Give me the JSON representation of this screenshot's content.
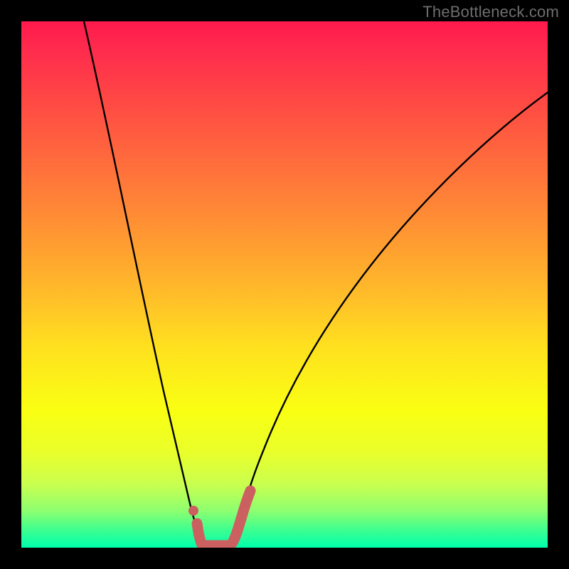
{
  "watermark": "TheBottleneck.com",
  "chart_data": {
    "type": "line",
    "title": "",
    "xlabel": "",
    "ylabel": "",
    "xlim": [
      0,
      100
    ],
    "ylim": [
      0,
      100
    ],
    "x": [
      12,
      14,
      16,
      18,
      20,
      22,
      24,
      26,
      28,
      30,
      31,
      32,
      33,
      34,
      35,
      36,
      37,
      38,
      39,
      40,
      42,
      44,
      46,
      50,
      55,
      60,
      65,
      70,
      75,
      80,
      85,
      90,
      95,
      100
    ],
    "values": [
      100,
      92,
      84,
      76,
      68,
      60,
      52,
      44,
      36,
      24,
      18,
      12,
      6,
      2,
      0,
      0,
      0,
      0,
      0,
      2,
      6,
      10,
      15,
      23,
      32,
      39,
      46,
      52,
      57,
      62,
      66,
      70,
      73,
      76
    ],
    "highlight_range_x": [
      31,
      40
    ],
    "gradient_stops": [
      {
        "pos": 0.0,
        "color": "#ff1a4d"
      },
      {
        "pos": 0.5,
        "color": "#ffe11f"
      },
      {
        "pos": 1.0,
        "color": "#00ffae"
      }
    ],
    "curve_color": "#000000",
    "highlight_color": "#cc5f5f"
  }
}
